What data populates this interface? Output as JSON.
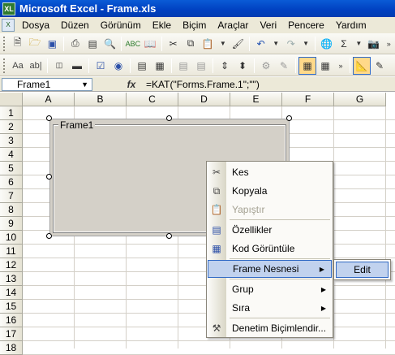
{
  "window": {
    "title": "Microsoft Excel - Frame.xls",
    "app_icon": "XL"
  },
  "menubar": {
    "items": [
      "Dosya",
      "Düzen",
      "Görünüm",
      "Ekle",
      "Biçim",
      "Araçlar",
      "Veri",
      "Pencere",
      "Yardım"
    ]
  },
  "toolbar1": {
    "icons": [
      "new-icon",
      "open-icon",
      "save-icon",
      "print-icon",
      "print-preview-icon",
      "preview-icon",
      "spelling-icon",
      "research-icon",
      "cut-icon",
      "copy-icon",
      "paste-icon",
      "format-painter-icon",
      "undo-icon",
      "redo-icon",
      "hyperlink-icon",
      "autosum-icon",
      "chart-icon",
      "more-icon"
    ]
  },
  "toolbar2": {
    "icons": [
      "label-icon",
      "editbox-icon",
      "groupbox-icon",
      "button-icon",
      "checkbox-icon",
      "option-button-icon",
      "listbox-icon",
      "combobox-icon",
      "combo-list-edit-icon",
      "combo-dropdown-edit-icon",
      "scrollbar-icon",
      "spinner-icon",
      "control-properties-icon",
      "edit-code-icon",
      "toggle-grid-icon",
      "run-dialog-icon",
      "more-icon",
      "design-mode-icon",
      "draw-icon"
    ],
    "text_icons": {
      "label": "Aa",
      "editbox": "ab|"
    }
  },
  "formulabar": {
    "namebox": "Frame1",
    "fx": "fx",
    "formula": "=KAT(\"Forms.Frame.1\";\"\")"
  },
  "sheet": {
    "columns": [
      "A",
      "B",
      "C",
      "D",
      "E",
      "F",
      "G"
    ],
    "rows": [
      "1",
      "2",
      "3",
      "4",
      "5",
      "6",
      "7",
      "8",
      "9",
      "10",
      "11",
      "12",
      "13",
      "14",
      "15",
      "16",
      "17",
      "18"
    ]
  },
  "frame": {
    "title": "Frame1"
  },
  "context_menu": {
    "items": [
      {
        "label": "Kes",
        "icon": "cut-icon"
      },
      {
        "label": "Kopyala",
        "icon": "copy-icon"
      },
      {
        "label": "Yapıştır",
        "icon": "paste-icon",
        "disabled": true
      },
      {
        "label": "Özellikler",
        "icon": "properties-icon"
      },
      {
        "label": "Kod Görüntüle",
        "icon": "view-code-icon"
      },
      {
        "label": "Frame Nesnesi",
        "submenu": true
      },
      {
        "label": "Grup",
        "submenu": true
      },
      {
        "label": "Sıra",
        "submenu": true
      },
      {
        "label": "Denetim Biçimlendir...",
        "icon": "format-control-icon"
      }
    ]
  },
  "submenu": {
    "items": [
      "Edit"
    ]
  },
  "colors": {
    "titlebar": "#0a5bd6",
    "menubar": "#ece9d8",
    "hover": "#c1d2ee",
    "hover_border": "#316ac5",
    "frame_bg": "#d4d0c8"
  }
}
